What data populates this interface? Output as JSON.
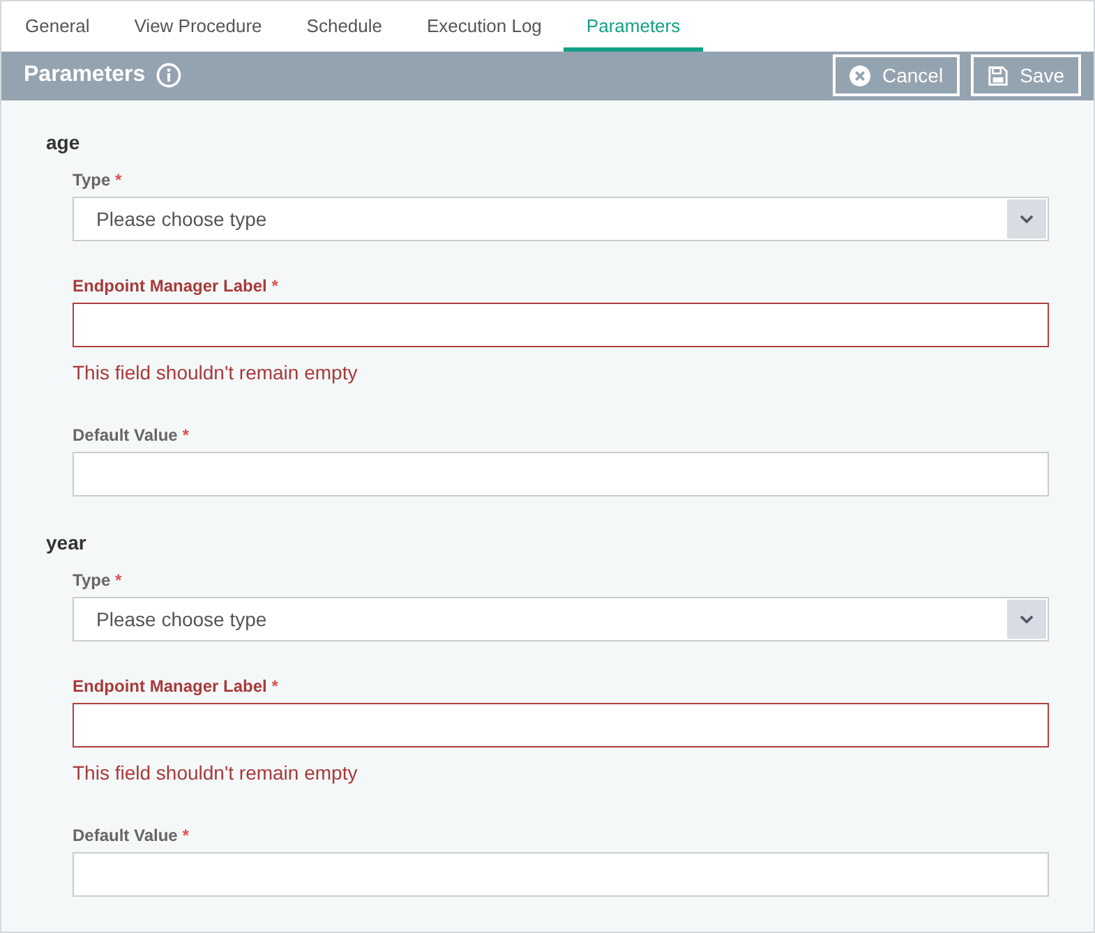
{
  "tabs": [
    {
      "label": "General",
      "selected": false
    },
    {
      "label": "View Procedure",
      "selected": false
    },
    {
      "label": "Schedule",
      "selected": false
    },
    {
      "label": "Execution Log",
      "selected": false
    },
    {
      "label": "Parameters",
      "selected": true
    }
  ],
  "header": {
    "title": "Parameters",
    "buttons": [
      {
        "kind": "cancel",
        "label": "Cancel"
      },
      {
        "kind": "save",
        "label": "Save"
      }
    ]
  },
  "parameters": [
    {
      "name": "age",
      "fields": [
        {
          "kind": "select",
          "label": "Type",
          "mark": "*",
          "placeholder": "Please choose type",
          "invalid": false
        },
        {
          "kind": "text",
          "label": "Endpoint Manager Label",
          "mark": "*",
          "invalid": true,
          "error": "This field shouldn't remain empty"
        },
        {
          "kind": "text",
          "label": "Default Value",
          "mark": "*",
          "invalid": false
        }
      ]
    },
    {
      "name": "year",
      "fields": [
        {
          "kind": "select",
          "label": "Type",
          "mark": "*",
          "placeholder": "Please choose type",
          "invalid": false
        },
        {
          "kind": "text",
          "label": "Endpoint Manager Label",
          "mark": "*",
          "invalid": true,
          "error": "This field shouldn't remain empty"
        },
        {
          "kind": "text",
          "label": "Default Value",
          "mark": "*",
          "invalid": false
        }
      ]
    }
  ]
}
